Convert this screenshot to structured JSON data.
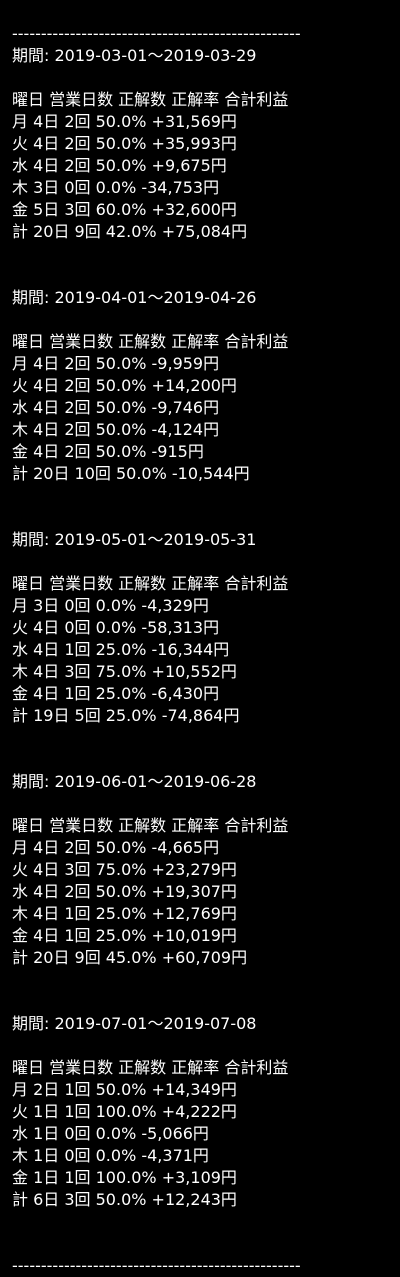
{
  "separator": "--------------------------------------------------",
  "header_row": "曜日 営業日数 正解数 正解率 合計利益",
  "period_label": "期間:",
  "blocks": [
    {
      "period": "2019-03-01～2019-03-29",
      "rows": [
        "月 4日 2回 50.0% +31,569円",
        "火 4日 2回 50.0% +35,993円",
        "水 4日 2回 50.0% +9,675円",
        "木 3日 0回 0.0% -34,753円",
        "金 5日 3回 60.0% +32,600円",
        "計 20日 9回 42.0% +75,084円"
      ]
    },
    {
      "period": "2019-04-01～2019-04-26",
      "rows": [
        "月 4日 2回 50.0% -9,959円",
        "火 4日 2回 50.0% +14,200円",
        "水 4日 2回 50.0% -9,746円",
        "木 4日 2回 50.0% -4,124円",
        "金 4日 2回 50.0% -915円",
        "計 20日 10回 50.0% -10,544円"
      ]
    },
    {
      "period": "2019-05-01～2019-05-31",
      "rows": [
        "月 3日 0回 0.0% -4,329円",
        "火 4日 0回 0.0% -58,313円",
        "水 4日 1回 25.0% -16,344円",
        "木 4日 3回 75.0% +10,552円",
        "金 4日 1回 25.0% -6,430円",
        "計 19日 5回 25.0% -74,864円"
      ]
    },
    {
      "period": "2019-06-01～2019-06-28",
      "rows": [
        "月 4日 2回 50.0% -4,665円",
        "火 4日 3回 75.0% +23,279円",
        "水 4日 2回 50.0% +19,307円",
        "木 4日 1回 25.0% +12,769円",
        "金 4日 1回 25.0% +10,019円",
        "計 20日 9回 45.0% +60,709円"
      ]
    },
    {
      "period": "2019-07-01～2019-07-08",
      "rows": [
        "月 2日 1回 50.0% +14,349円",
        "火 1日 1回 100.0% +4,222円",
        "水 1日 0回 0.0% -5,066円",
        "木 1日 0回 0.0% -4,371円",
        "金 1日 1回 100.0% +3,109円",
        "計 6日 3回 50.0% +12,243円"
      ]
    }
  ]
}
